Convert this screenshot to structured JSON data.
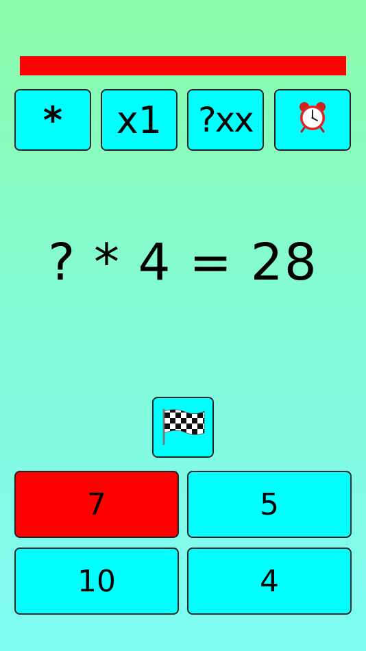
{
  "progress": {
    "fraction_remaining": 1.0,
    "color": "#ff0000"
  },
  "toolbar": {
    "operation_label": "*",
    "multiplier_label": "x1",
    "unknown_label": "?xx",
    "timer_icon": "alarm-clock-icon"
  },
  "question": {
    "operand1": "?",
    "operator": "*",
    "operand2": "4",
    "equals": "=",
    "result": "28"
  },
  "finish": {
    "icon": "checkered-flag-icon"
  },
  "answers": [
    {
      "label": "7",
      "state": "wrong"
    },
    {
      "label": "5",
      "state": "normal"
    },
    {
      "label": "10",
      "state": "normal"
    },
    {
      "label": "4",
      "state": "normal"
    }
  ],
  "colors": {
    "button": "#00ffff",
    "wrong": "#ff0000",
    "background_top": "#8cfba8",
    "background_bottom": "#80fbf4"
  }
}
